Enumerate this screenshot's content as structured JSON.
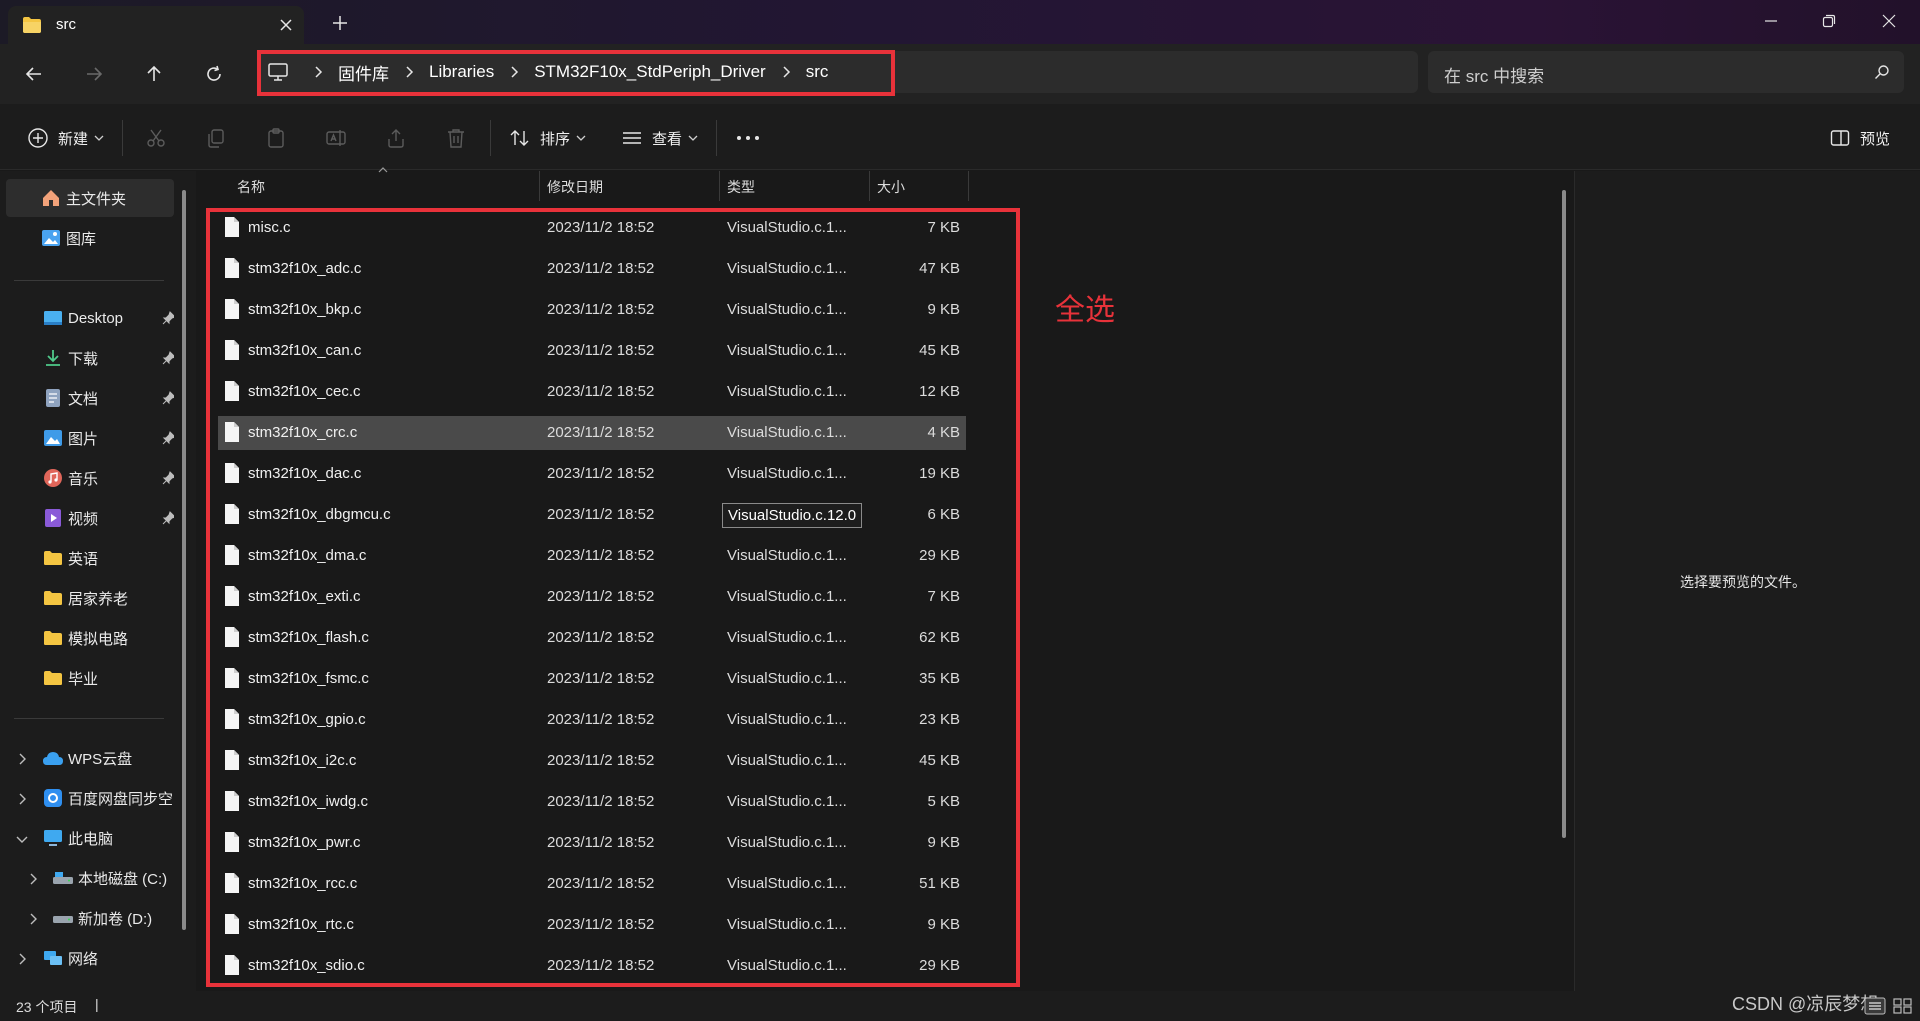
{
  "tab": {
    "title": "src"
  },
  "breadcrumb": [
    "固件库",
    "Libraries",
    "STM32F10x_StdPeriph_Driver",
    "src"
  ],
  "search": {
    "placeholder": "在 src 中搜索"
  },
  "toolbar": {
    "new_label": "新建",
    "sort_label": "排序",
    "view_label": "查看",
    "preview_label": "预览"
  },
  "sidebar": {
    "top": [
      {
        "label": "主文件夹",
        "icon": "home-icon"
      },
      {
        "label": "图库",
        "icon": "gallery-icon"
      }
    ],
    "quick": [
      {
        "label": "Desktop",
        "icon": "desktop-icon",
        "pinned": true
      },
      {
        "label": "下载",
        "icon": "download-icon",
        "pinned": true
      },
      {
        "label": "文档",
        "icon": "documents-icon",
        "pinned": true
      },
      {
        "label": "图片",
        "icon": "pictures-icon",
        "pinned": true
      },
      {
        "label": "音乐",
        "icon": "music-icon",
        "pinned": true
      },
      {
        "label": "视频",
        "icon": "videos-icon",
        "pinned": true
      },
      {
        "label": "英语",
        "icon": "folder-icon",
        "pinned": false
      },
      {
        "label": "居家养老",
        "icon": "folder-icon",
        "pinned": false
      },
      {
        "label": "模拟电路",
        "icon": "folder-icon",
        "pinned": false
      },
      {
        "label": "毕业",
        "icon": "folder-icon",
        "pinned": false
      }
    ],
    "tree": [
      {
        "label": "WPS云盘",
        "icon": "wps-cloud-icon"
      },
      {
        "label": "百度网盘同步空",
        "icon": "baidu-netdisk-icon"
      },
      {
        "label": "此电脑",
        "icon": "this-pc-icon"
      },
      {
        "label": "本地磁盘 (C:)",
        "icon": "drive-icon"
      },
      {
        "label": "新加卷 (D:)",
        "icon": "drive-icon"
      },
      {
        "label": "网络",
        "icon": "network-icon"
      }
    ]
  },
  "columns": {
    "name": "名称",
    "date": "修改日期",
    "type": "类型",
    "size": "大小"
  },
  "files": [
    {
      "name": "misc.c",
      "date": "2023/11/2 18:52",
      "type": "VisualStudio.c.1...",
      "size": "7 KB"
    },
    {
      "name": "stm32f10x_adc.c",
      "date": "2023/11/2 18:52",
      "type": "VisualStudio.c.1...",
      "size": "47 KB"
    },
    {
      "name": "stm32f10x_bkp.c",
      "date": "2023/11/2 18:52",
      "type": "VisualStudio.c.1...",
      "size": "9 KB"
    },
    {
      "name": "stm32f10x_can.c",
      "date": "2023/11/2 18:52",
      "type": "VisualStudio.c.1...",
      "size": "45 KB"
    },
    {
      "name": "stm32f10x_cec.c",
      "date": "2023/11/2 18:52",
      "type": "VisualStudio.c.1...",
      "size": "12 KB"
    },
    {
      "name": "stm32f10x_crc.c",
      "date": "2023/11/2 18:52",
      "type": "VisualStudio.c.1...",
      "size": "4 KB",
      "selected": true
    },
    {
      "name": "stm32f10x_dac.c",
      "date": "2023/11/2 18:52",
      "type": "VisualStudio.c.1...",
      "size": "19 KB"
    },
    {
      "name": "stm32f10x_dbgmcu.c",
      "date": "2023/11/2 18:52",
      "type": "",
      "size": "6 KB"
    },
    {
      "name": "stm32f10x_dma.c",
      "date": "2023/11/2 18:52",
      "type": "VisualStudio.c.1...",
      "size": "29 KB"
    },
    {
      "name": "stm32f10x_exti.c",
      "date": "2023/11/2 18:52",
      "type": "VisualStudio.c.1...",
      "size": "7 KB"
    },
    {
      "name": "stm32f10x_flash.c",
      "date": "2023/11/2 18:52",
      "type": "VisualStudio.c.1...",
      "size": "62 KB"
    },
    {
      "name": "stm32f10x_fsmc.c",
      "date": "2023/11/2 18:52",
      "type": "VisualStudio.c.1...",
      "size": "35 KB"
    },
    {
      "name": "stm32f10x_gpio.c",
      "date": "2023/11/2 18:52",
      "type": "VisualStudio.c.1...",
      "size": "23 KB"
    },
    {
      "name": "stm32f10x_i2c.c",
      "date": "2023/11/2 18:52",
      "type": "VisualStudio.c.1...",
      "size": "45 KB"
    },
    {
      "name": "stm32f10x_iwdg.c",
      "date": "2023/11/2 18:52",
      "type": "VisualStudio.c.1...",
      "size": "5 KB"
    },
    {
      "name": "stm32f10x_pwr.c",
      "date": "2023/11/2 18:52",
      "type": "VisualStudio.c.1...",
      "size": "9 KB"
    },
    {
      "name": "stm32f10x_rcc.c",
      "date": "2023/11/2 18:52",
      "type": "VisualStudio.c.1...",
      "size": "51 KB"
    },
    {
      "name": "stm32f10x_rtc.c",
      "date": "2023/11/2 18:52",
      "type": "VisualStudio.c.1...",
      "size": "9 KB"
    },
    {
      "name": "stm32f10x_sdio.c",
      "date": "2023/11/2 18:52",
      "type": "VisualStudio.c.1...",
      "size": "29 KB"
    }
  ],
  "tooltip": "VisualStudio.c.12.0",
  "annotation": "全选",
  "preview": {
    "empty_text": "选择要预览的文件。"
  },
  "status": {
    "count": "23 个项目",
    "separator": "|"
  },
  "watermark": "CSDN @凉辰梦想",
  "colors": {
    "highlight": "#e8323a",
    "folder": "#f4c542",
    "accent": "#5aa7f2"
  }
}
